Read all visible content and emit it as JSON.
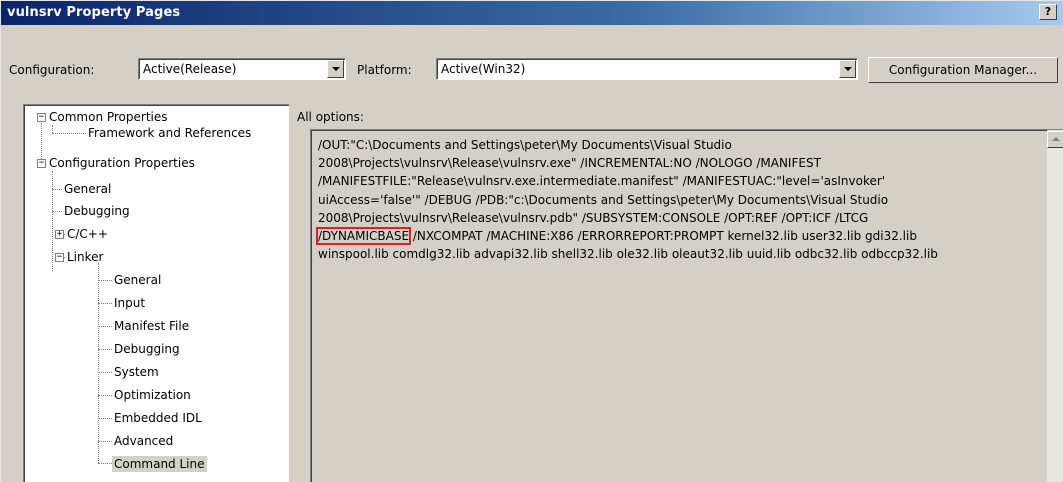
{
  "window": {
    "title": "vulnsrv Property Pages",
    "help_label": "?"
  },
  "toolbar": {
    "configuration_label": "Configuration:",
    "configuration_value": "Active(Release)",
    "platform_label": "Platform:",
    "platform_value": "Active(Win32)",
    "config_manager_label": "Configuration Manager..."
  },
  "tree": {
    "items": [
      {
        "label": "Common Properties",
        "expander": "−"
      },
      {
        "label": "Framework and References"
      },
      {
        "label": "Configuration Properties",
        "expander": "−"
      },
      {
        "label": "General"
      },
      {
        "label": "Debugging"
      },
      {
        "label": "C/C++",
        "expander": "+"
      },
      {
        "label": "Linker",
        "expander": "−"
      },
      {
        "label": "General"
      },
      {
        "label": "Input"
      },
      {
        "label": "Manifest File"
      },
      {
        "label": "Debugging"
      },
      {
        "label": "System"
      },
      {
        "label": "Optimization"
      },
      {
        "label": "Embedded IDL"
      },
      {
        "label": "Advanced"
      },
      {
        "label": "Command Line"
      }
    ]
  },
  "options": {
    "label": "All options:",
    "lines": [
      "/OUT:\"C:\\Documents and Settings\\peter\\My Documents\\Visual Studio",
      "2008\\Projects\\vulnsrv\\Release\\vulnsrv.exe\" /INCREMENTAL:NO /NOLOGO /MANIFEST",
      "/MANIFESTFILE:\"Release\\vulnsrv.exe.intermediate.manifest\" /MANIFESTUAC:\"level='asInvoker'",
      "uiAccess='false'\" /DEBUG /PDB:\"c:\\Documents and Settings\\peter\\My Documents\\Visual Studio",
      "2008\\Projects\\vulnsrv\\Release\\vulnsrv.pdb\" /SUBSYSTEM:CONSOLE /OPT:REF /OPT:ICF /LTCG"
    ],
    "line6_highlight": "/DYNAMICBASE",
    "line6_rest": " /NXCOMPAT /MACHINE:X86 /ERRORREPORT:PROMPT kernel32.lib user32.lib gdi32.lib",
    "line7": "winspool.lib comdlg32.lib advapi32.lib shell32.lib ole32.lib oleaut32.lib uuid.lib odbc32.lib odbccp32.lib",
    "highlight_color": "#e02020"
  }
}
